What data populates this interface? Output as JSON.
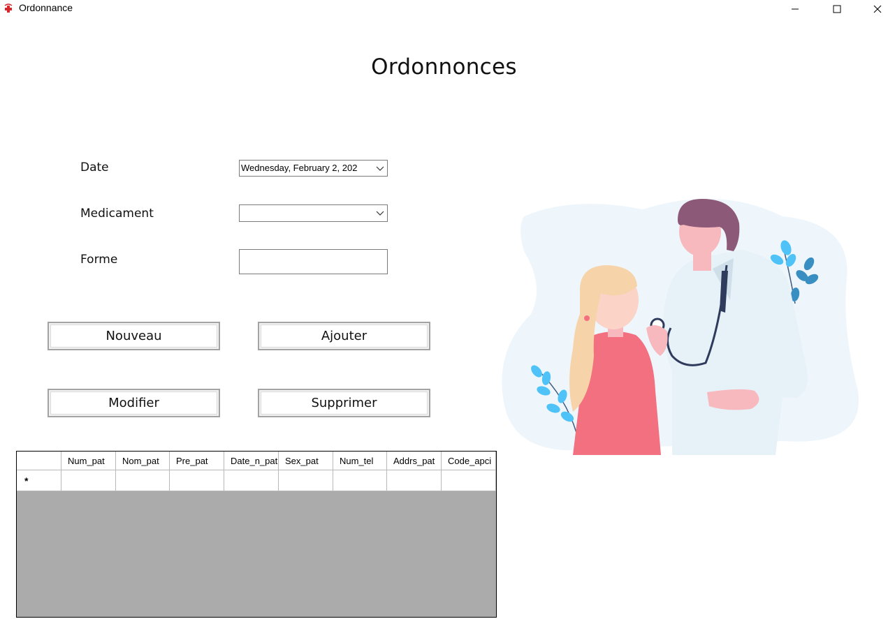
{
  "window": {
    "title": "Ordonnance",
    "app_icon": "medical-cross-icon",
    "controls": [
      "minimize-icon",
      "maximize-icon",
      "close-icon"
    ]
  },
  "page": {
    "heading": "Ordonnonces"
  },
  "form": {
    "date": {
      "label": "Date",
      "value": "Wednesday,   February    2, 202"
    },
    "medicament": {
      "label": "Medicament",
      "value": ""
    },
    "forme": {
      "label": "Forme",
      "value": ""
    }
  },
  "buttons": {
    "nouveau": "Nouveau",
    "ajouter": "Ajouter",
    "modifier": "Modifier",
    "supprimer": "Supprimer"
  },
  "grid": {
    "columns": [
      "Num_pat",
      "Nom_pat",
      "Pre_pat",
      "Date_n_pat",
      "Sex_pat",
      "Num_tel",
      "Addrs_pat",
      "Code_apci"
    ],
    "new_row_marker": "*"
  },
  "colors": {
    "accent_red": "#d8262c",
    "grid_background": "#ababab",
    "illustration_blob": "#eef6fc",
    "shirt_pink": "#f2707f",
    "hair_purple": "#8c5a78",
    "leaf_blue": "#4fc3f7"
  }
}
